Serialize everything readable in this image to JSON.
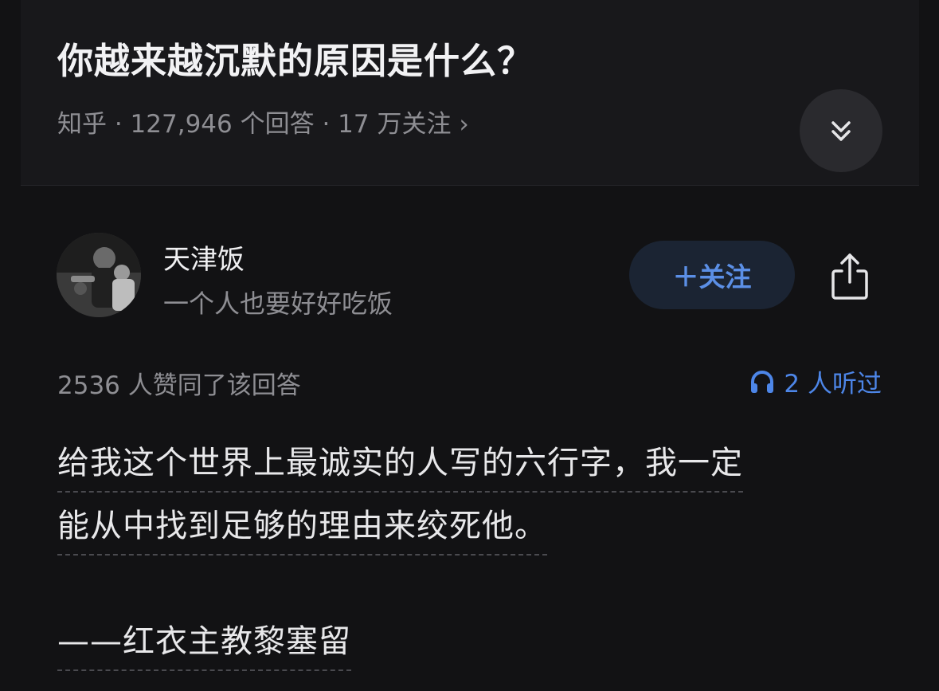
{
  "question": {
    "title": "你越来越沉默的原因是什么？",
    "meta": "知乎 · 127,946 个回答 · 17 万关注 ›"
  },
  "icons": {
    "collapse": "double-chevron-down-icon",
    "share": "share-icon",
    "listen": "headphones-icon"
  },
  "author": {
    "name": "天津饭",
    "bio": "一个人也要好好吃饭",
    "follow_label": "＋关注"
  },
  "answer": {
    "votes": "2536 人赞同了该回答",
    "listeners": "2 人听过",
    "lines": [
      "给我这个世界上最诚实的人写的六行字，我一定",
      "能从中找到足够的理由来绞死他。",
      "——红衣主教黎塞留"
    ]
  },
  "colors": {
    "background": "#121214",
    "accent_blue": "#4d86e8",
    "follow_bg": "#1b2433"
  }
}
